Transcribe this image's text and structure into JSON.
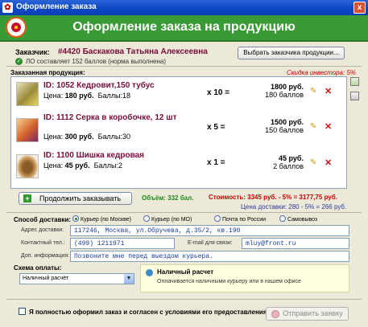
{
  "window": {
    "title": "Оформление заказа",
    "close": "x"
  },
  "banner": {
    "title": "Оформление заказа на продукцию"
  },
  "customer": {
    "label": "Заказчик:",
    "name": "#4420 Баскакова Татьяна Алексеевна",
    "lo_status": "ЛО составляет 152 баллов (норма выполнена)",
    "choose_button": "Выбрать заказчика продукции..."
  },
  "products": {
    "label": "Заказанная продукция:",
    "discount_note": "Скидка инвестора: 5%",
    "price_prefix": "Цена:",
    "points_prefix": "Баллы:",
    "items": [
      {
        "id": "ID: 1052  Кедровит,150 тубус",
        "price": "180 руб.",
        "points": "18",
        "qty": "x 10 =",
        "sum": "1800 руб.",
        "sum_points": "180 баллов"
      },
      {
        "id": "ID: 1112  Серка в коробочке, 12 шт",
        "price": "300 руб.",
        "points": "30",
        "qty": "x 5 =",
        "sum": "1500 руб.",
        "sum_points": "150 баллов"
      },
      {
        "id": "ID: 1100  Шишка кедровая",
        "price": "45 руб.",
        "points": "2",
        "qty": "x 1 =",
        "sum": "45 руб.",
        "sum_points": "2 баллов"
      }
    ]
  },
  "summary": {
    "continue_button": "Продолжить заказывать",
    "volume": "Объём: 332 бал.",
    "cost": "Стоимость: 3345 руб. - 5% = 3177,75 руб.",
    "delivery_price": "Цена доставки: 280 - 5% = 266 руб."
  },
  "delivery": {
    "label": "Способ доставки:",
    "options": [
      "Курьер (по Москве)",
      "Курьер (по МО)",
      "Почта по России",
      "Самовывоз"
    ],
    "selected": 0,
    "address_label": "Адрес доставки:",
    "address": "117246, Москва, ул.Обручева, д.35/2, кв.190",
    "phone_label": "Контактный тел.:",
    "phone": "(499) 1211971",
    "email_label": "E-mail для связи:",
    "email": "mluy@front.ru",
    "extra_label": "Доп. информация:",
    "extra": "Позвоните мне перед выездом курьера."
  },
  "payment": {
    "label": "Схема оплаты:",
    "selected": "Наличный расчёт",
    "info_title": "Наличный расчет",
    "info_text": "Оплачивается наличными курьеру или в нашем офисе"
  },
  "footer": {
    "agree_text": "Я полностью оформил заказ и согласен с условиями его предоставления.",
    "send_button": "Отправить заявку"
  },
  "colors": {
    "banner": "#3a9a35",
    "accent_red": "#cc0000",
    "product_id": "#7a0a3a",
    "titlebar": "#0a46c4"
  }
}
